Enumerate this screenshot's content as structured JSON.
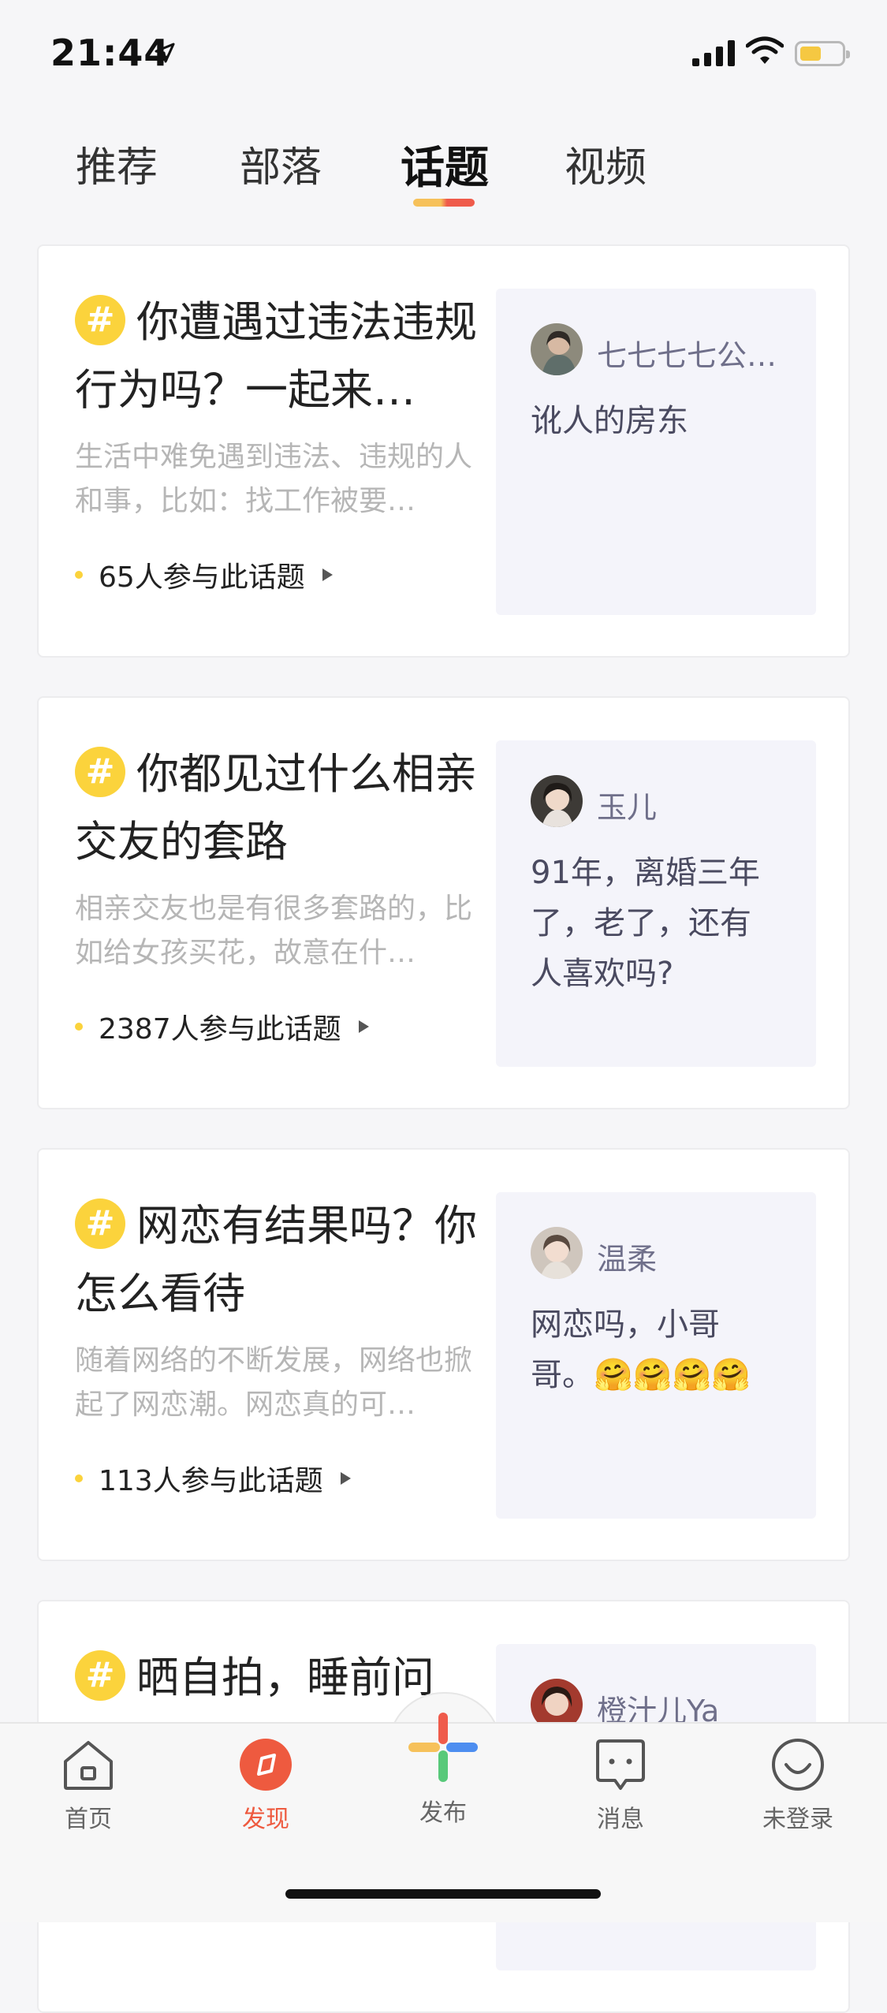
{
  "status_bar": {
    "time": "21:44"
  },
  "tabs": [
    {
      "label": "推荐"
    },
    {
      "label": "部落"
    },
    {
      "label": "话题"
    },
    {
      "label": "视频"
    }
  ],
  "active_tab": "话题",
  "topics": [
    {
      "title": "你遭遇过违法违规行为吗？一起来…",
      "description": "生活中难免遇到违法、违规的人和事，比如：找工作被要…",
      "participants": "65人参与此话题",
      "preview": {
        "username": "七七七七公…",
        "reply": "讹人的房东"
      }
    },
    {
      "title": "你都见过什么相亲交友的套路",
      "description": "相亲交友也是有很多套路的，比如给女孩买花，故意在什…",
      "participants": "2387人参与此话题",
      "preview": {
        "username": "玉儿",
        "reply": "91年，离婚三年了，老了，还有人喜欢吗?"
      }
    },
    {
      "title": "网恋有结果吗？你怎么看待",
      "description": "随着网络的不断发展，网络也掀起了网恋潮。网恋真的可…",
      "participants": "113人参与此话题",
      "preview": {
        "username": "温柔",
        "reply": "网恋吗，小哥哥。🤗🤗🤗🤗"
      }
    },
    {
      "title": "晒自拍，睡前问",
      "description": "",
      "participants": "",
      "preview": {
        "username": "橙汁儿Ya",
        "reply": ""
      }
    }
  ],
  "bottom_nav": {
    "home": "首页",
    "discover": "发现",
    "publish": "发布",
    "messages": "消息",
    "profile": "未登录"
  },
  "colors": {
    "accent": "#ee5a3f",
    "hash_badge": "#fbd33c",
    "preview_bg": "#f4f4fa"
  },
  "icons": [
    "location-arrow-icon",
    "signal-icon",
    "wifi-icon",
    "battery-icon",
    "hash-icon",
    "home-icon",
    "discover-icon",
    "plus-icon",
    "message-icon",
    "smile-icon"
  ]
}
